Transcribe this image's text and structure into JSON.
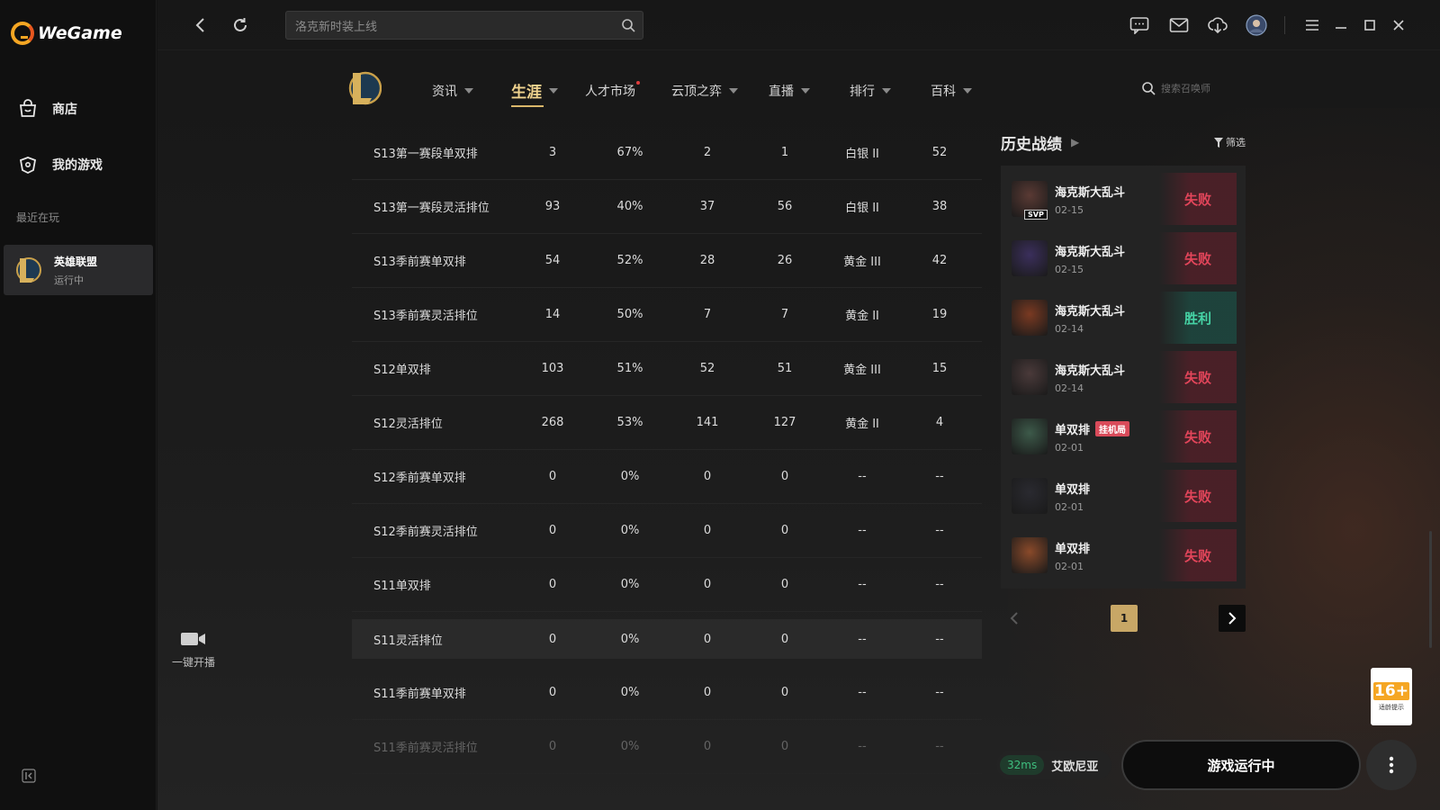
{
  "app": {
    "brand": "WeGame"
  },
  "sidebar": {
    "items": [
      {
        "label": "商店",
        "icon": "shop-bag-icon"
      },
      {
        "label": "我的游戏",
        "icon": "game-controller-icon"
      }
    ],
    "recent_title": "最近在玩",
    "recent_game": {
      "name": "英雄联盟",
      "status": "运行中"
    },
    "stream_label": "一键开播"
  },
  "topbar": {
    "search_placeholder": "洛克新时装上线"
  },
  "game_nav": {
    "items": [
      {
        "label": "资讯",
        "has_caret": true
      },
      {
        "label": "生涯",
        "has_caret": true,
        "active": true
      },
      {
        "label": "人才市场",
        "has_caret": false,
        "dot": true
      },
      {
        "label": "云顶之弈",
        "has_caret": true
      },
      {
        "label": "直播",
        "has_caret": true
      },
      {
        "label": "排行",
        "has_caret": true
      },
      {
        "label": "百科",
        "has_caret": true
      }
    ],
    "summoner_search_placeholder": "搜索召唤师"
  },
  "rank_table": {
    "rows": [
      {
        "name": "S13第一赛段单双排",
        "games": "3",
        "winrate": "67%",
        "wins": "2",
        "losses": "1",
        "tier": "白银 II",
        "points": "52"
      },
      {
        "name": "S13第一赛段灵活排位",
        "games": "93",
        "winrate": "40%",
        "wins": "37",
        "losses": "56",
        "tier": "白银 II",
        "points": "38"
      },
      {
        "name": "S13季前赛单双排",
        "games": "54",
        "winrate": "52%",
        "wins": "28",
        "losses": "26",
        "tier": "黄金 III",
        "points": "42"
      },
      {
        "name": "S13季前赛灵活排位",
        "games": "14",
        "winrate": "50%",
        "wins": "7",
        "losses": "7",
        "tier": "黄金 II",
        "points": "19"
      },
      {
        "name": "S12单双排",
        "games": "103",
        "winrate": "51%",
        "wins": "52",
        "losses": "51",
        "tier": "黄金 III",
        "points": "15"
      },
      {
        "name": "S12灵活排位",
        "games": "268",
        "winrate": "53%",
        "wins": "141",
        "losses": "127",
        "tier": "黄金 II",
        "points": "4"
      },
      {
        "name": "S12季前赛单双排",
        "games": "0",
        "winrate": "0%",
        "wins": "0",
        "losses": "0",
        "tier": "--",
        "points": "--"
      },
      {
        "name": "S12季前赛灵活排位",
        "games": "0",
        "winrate": "0%",
        "wins": "0",
        "losses": "0",
        "tier": "--",
        "points": "--"
      },
      {
        "name": "S11单双排",
        "games": "0",
        "winrate": "0%",
        "wins": "0",
        "losses": "0",
        "tier": "--",
        "points": "--"
      },
      {
        "name": "S11灵活排位",
        "games": "0",
        "winrate": "0%",
        "wins": "0",
        "losses": "0",
        "tier": "--",
        "points": "--"
      },
      {
        "name": "S11季前赛单双排",
        "games": "0",
        "winrate": "0%",
        "wins": "0",
        "losses": "0",
        "tier": "--",
        "points": "--"
      },
      {
        "name": "S11季前赛灵活排位",
        "games": "0",
        "winrate": "0%",
        "wins": "0",
        "losses": "0",
        "tier": "--",
        "points": "--"
      }
    ]
  },
  "history": {
    "title": "历史战绩",
    "filter_label": "筛选",
    "matches": [
      {
        "mode": "海克斯大乱斗",
        "date": "02-15",
        "result": "失败",
        "win": false,
        "svp": "SVP",
        "color": "#5a3a34"
      },
      {
        "mode": "海克斯大乱斗",
        "date": "02-15",
        "result": "失败",
        "win": false,
        "color": "#3b2f5c"
      },
      {
        "mode": "海克斯大乱斗",
        "date": "02-14",
        "result": "胜利",
        "win": true,
        "color": "#7a3a22"
      },
      {
        "mode": "海克斯大乱斗",
        "date": "02-14",
        "result": "失败",
        "win": false,
        "color": "#4a3a3a"
      },
      {
        "mode": "单双排",
        "date": "02-01",
        "result": "失败",
        "win": false,
        "tag": "挂机局",
        "color": "#3d5a4a"
      },
      {
        "mode": "单双排",
        "date": "02-01",
        "result": "失败",
        "win": false,
        "color": "#2a2a30"
      },
      {
        "mode": "单双排",
        "date": "02-01",
        "result": "失败",
        "win": false,
        "color": "#8a4a2a"
      }
    ],
    "current_page": "1"
  },
  "bottom": {
    "age_rating": "16+",
    "age_caption": "适龄提示",
    "ping": "32ms",
    "server": "艾欧尼亚",
    "play_label": "游戏运行中"
  }
}
